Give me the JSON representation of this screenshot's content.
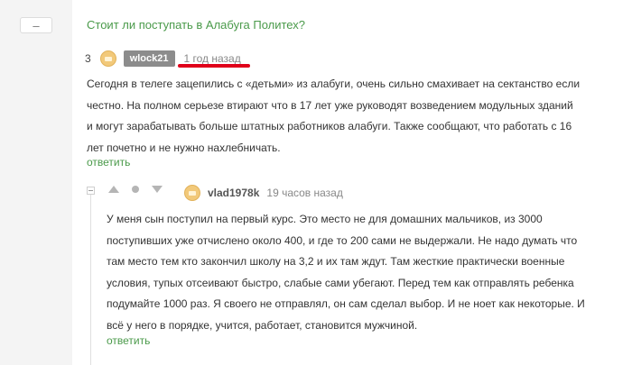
{
  "collapse_button": {
    "label": "–"
  },
  "post": {
    "title": "Стоит ли поступать в Алабуга Политех?"
  },
  "comment": {
    "rating": "3",
    "username": "wlock21",
    "time": "1 год назад",
    "lines": [
      "Сегодня в телеге зацепились с «детьми» из алабуги, очень сильно смахивает на сектанство если",
      "честно. На полном серьезе втирают что в 17 лет уже руководят возведением модульных зданий",
      "и могут зарабатывать больше штатных работников алабуги.  Также сообщают, что работать с 16",
      "лет почетно и не нужно нахлебничать."
    ],
    "reply_label": "ответить"
  },
  "reply": {
    "username": "vlad1978k",
    "time": "19 часов назад",
    "lines": [
      "У меня сын поступил на первый курс. Это место не для домашних мальчиков, из 3000",
      "поступивших уже отчислено около 400, и где то 200 сами не выдержали. Не надо думать что",
      "там место тем кто закончил школу на 3,2 и их там ждут. Там жесткие практически военные",
      "условия, тупых отсеивают быстро, слабые сами убегают. Перед тем как отправлять ребенка",
      "подумайте 1000 раз. Я своего не отправлял, он сам сделал выбор. И не ноет как некоторые. И",
      "всё у него в порядке, учится, работает, становится мужчиной."
    ],
    "reply_label": "ответить"
  },
  "colors": {
    "link_green": "#4a9a4a",
    "highlight_red": "#e0001a",
    "badge_gray": "#8c8c8c"
  }
}
